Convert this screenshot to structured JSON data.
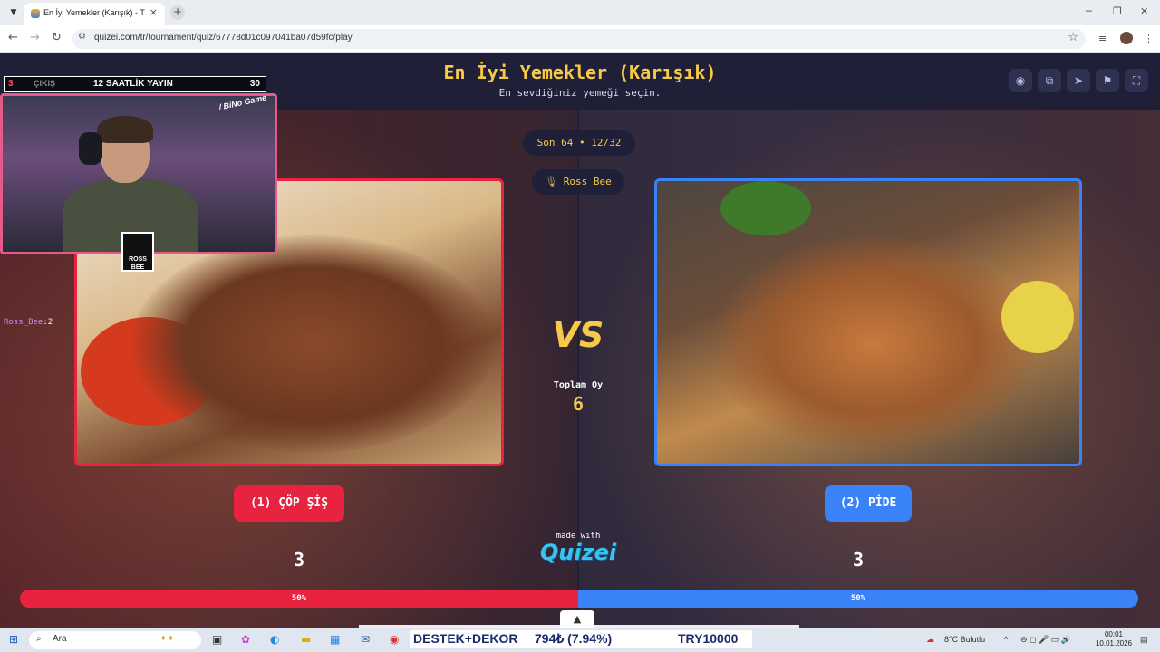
{
  "browser": {
    "tab_title": "En İyi Yemekler (Karışık) - Tier L",
    "url": "quizei.com/tr/tournament/quiz/67778d01c097041ba07d59fc/play",
    "tab_menu_icon": "chevron-down-icon",
    "close_icon": "×",
    "new_tab_icon": "+"
  },
  "header": {
    "title": "En İyi Yemekler (Karışık)",
    "subtitle": "En sevdiğiniz yemeği seçin.",
    "buttons": [
      "eye-icon",
      "share-icon",
      "send-icon",
      "flag-icon",
      "fullscreen-icon"
    ]
  },
  "round": {
    "label": "Son 64 • 12/32",
    "voter": "Ross_Bee"
  },
  "left": {
    "choice_label": "(1) ÇÖP ŞİŞ",
    "votes": "3",
    "percent": "50%",
    "color": "#e8233f"
  },
  "right": {
    "choice_label": "(2) PİDE",
    "votes": "3",
    "percent": "50%",
    "color": "#3a82f7"
  },
  "center": {
    "vs": "VS",
    "total_label": "Toplam Oy",
    "total_value": "6",
    "made_with": "made with",
    "brand": "Quizei"
  },
  "stream": {
    "counter_left": "3",
    "exit_label": "ÇIKIŞ",
    "title": "12 SAATLİK YAYIN",
    "counter_right": "30",
    "badge": "/ BiNo Game",
    "logo": "ROSS BEE",
    "chat_name": "Ross_Bee",
    "chat_text": ":2"
  },
  "taskbar": {
    "search_placeholder": "Ara",
    "ticker_1": "DESTEK+DEKOR",
    "ticker_2": "794₺ (7.94%)",
    "ticker_3": "TRY10000",
    "weather": "8°C  Bulutlu",
    "time": "00:01",
    "date": "10.01.2026"
  }
}
